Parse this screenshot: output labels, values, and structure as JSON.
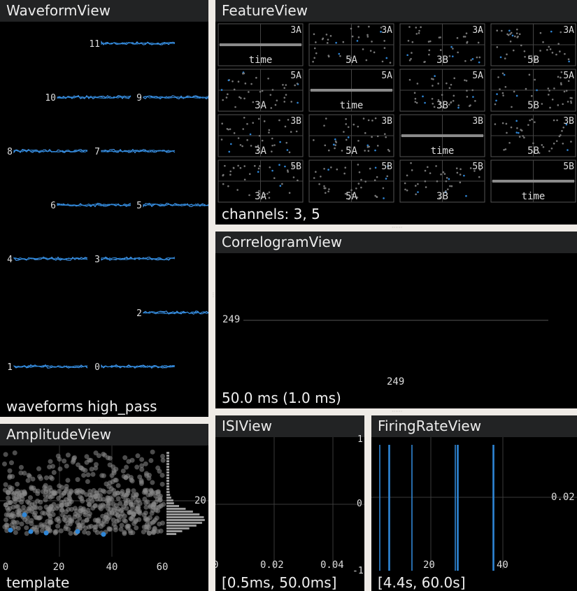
{
  "colors": {
    "accent": "#2f86d6",
    "gray": "#8a8a8a",
    "panel": "#000000",
    "title": "#222324",
    "bg": "#efebe6"
  },
  "waveform": {
    "title": "WaveformView",
    "status": "waveforms high_pass",
    "channels": [
      "11",
      "10",
      "9",
      "8",
      "7",
      "6",
      "5",
      "4",
      "3",
      "2",
      "1",
      "0"
    ]
  },
  "feature": {
    "title": "FeatureView",
    "status": "channels: 3, 5",
    "cells": [
      {
        "corner": "3A",
        "label": "time"
      },
      {
        "corner": "3A",
        "label": "5A"
      },
      {
        "corner": "3A",
        "label": "3B"
      },
      {
        "corner": "3A",
        "label": "5B"
      },
      {
        "corner": "5A",
        "label": "3A"
      },
      {
        "corner": "5A",
        "label": "time"
      },
      {
        "corner": "5A",
        "label": "3B"
      },
      {
        "corner": "5A",
        "label": "5B"
      },
      {
        "corner": "3B",
        "label": "3A"
      },
      {
        "corner": "3B",
        "label": "5A"
      },
      {
        "corner": "3B",
        "label": "time"
      },
      {
        "corner": "3B",
        "label": "5B"
      },
      {
        "corner": "5B",
        "label": "3A"
      },
      {
        "corner": "5B",
        "label": "5A"
      },
      {
        "corner": "5B",
        "label": "3B"
      },
      {
        "corner": "5B",
        "label": "time"
      }
    ]
  },
  "correlogram": {
    "title": "CorrelogramView",
    "status": "50.0 ms (1.0 ms)",
    "y_label": "249",
    "x_label": "249"
  },
  "amplitude": {
    "title": "AmplitudeView",
    "status": "template",
    "x_ticks": [
      "0",
      "20",
      "40",
      "60"
    ],
    "y_tick": "20"
  },
  "isi": {
    "title": "ISIView",
    "status": "[0.5ms, 50.0ms]",
    "x_ticks": [
      "0",
      "0.02",
      "0.04"
    ],
    "y_ticks": [
      "1",
      "0",
      "-1"
    ]
  },
  "firing": {
    "title": "FiringRateView",
    "status": "[4.4s, 60.0s]",
    "x_ticks": [
      "20",
      "40"
    ],
    "y_tick": "0.02"
  }
}
